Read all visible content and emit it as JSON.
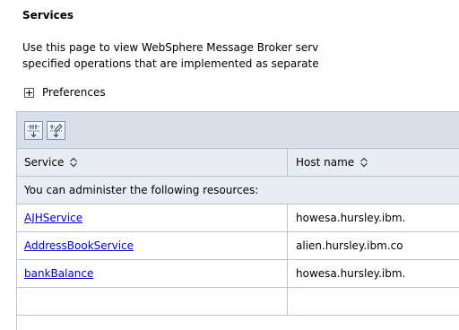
{
  "page": {
    "title": "Services",
    "description_line1": "Use this page to view WebSphere Message Broker serv",
    "description_line2": "specified operations that are implemented as separate",
    "preferences_label": "Preferences"
  },
  "table": {
    "columns": [
      "Service",
      "Host name"
    ],
    "group_label": "You can administer the following resources:",
    "rows": [
      {
        "service": "AJHService",
        "host": "howesa.hursley.ibm."
      },
      {
        "service": "AddressBookService",
        "host": "alien.hursley.ibm.co"
      },
      {
        "service": "bankBalance",
        "host": "howesa.hursley.ibm."
      },
      {
        "service": "",
        "host": ""
      }
    ]
  },
  "icons": {
    "preferences_toggle": "expand-plus-icon",
    "toolbar": [
      "select-all-icon",
      "deselect-all-icon"
    ],
    "sort": "sort-arrows-icon"
  },
  "colors": {
    "header_bg": "#e8edf4",
    "toolbar_bg": "#d6dfea",
    "border": "#b9c4d2",
    "link": "#0000cc"
  }
}
